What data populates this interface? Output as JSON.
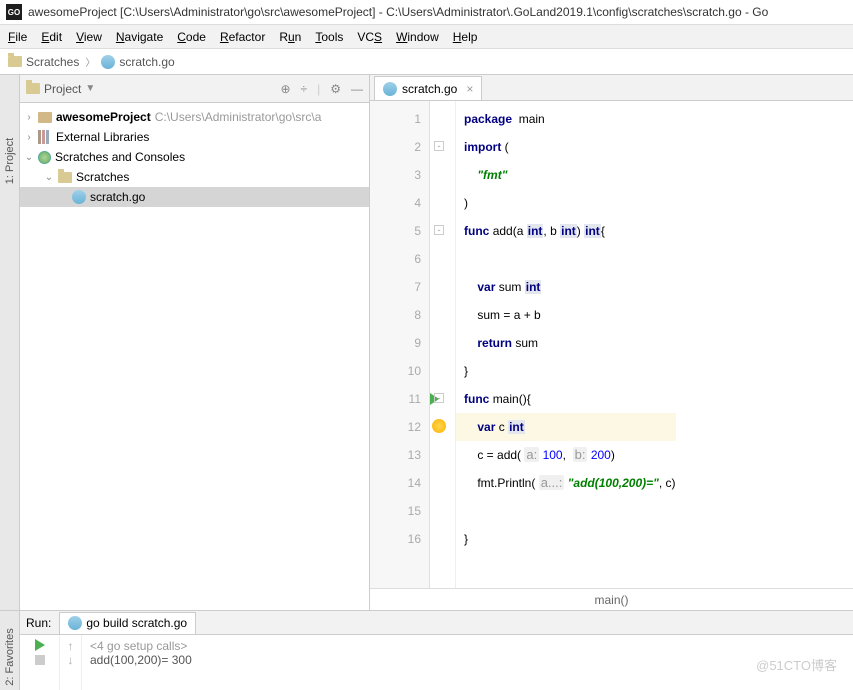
{
  "window": {
    "title": "awesomeProject [C:\\Users\\Administrator\\go\\src\\awesomeProject] - C:\\Users\\Administrator\\.GoLand2019.1\\config\\scratches\\scratch.go - Go"
  },
  "menu": [
    "File",
    "Edit",
    "View",
    "Navigate",
    "Code",
    "Refactor",
    "Run",
    "Tools",
    "VCS",
    "Window",
    "Help"
  ],
  "nav": {
    "root": "Scratches",
    "file": "scratch.go"
  },
  "project": {
    "title": "Project",
    "root": {
      "name": "awesomeProject",
      "path": "C:\\Users\\Administrator\\go\\src\\a"
    },
    "ext": "External Libraries",
    "scr": "Scratches and Consoles",
    "scratches": "Scratches",
    "file": "scratch.go"
  },
  "tabs": {
    "file": "scratch.go"
  },
  "code": {
    "lines": [
      1,
      2,
      3,
      4,
      5,
      6,
      7,
      8,
      9,
      10,
      11,
      12,
      13,
      14,
      15,
      16
    ],
    "pkg": "package",
    "main": "main",
    "import": "import",
    "fmt": "\"fmt\"",
    "func": "func",
    "add": "add",
    "a": "a",
    "int": "int",
    "b": "b",
    "var": "var",
    "sum": "sum",
    "assign": "sum = a + b",
    "return": "return",
    "mainfn": "main",
    "c": "c",
    "call": "c = add(",
    "a100": "a:",
    "v100": "100",
    "b200": "b:",
    "v200": "200",
    "println": "fmt.Println(",
    "ahint": "a...:",
    "strv": "\"add(100,200)=\"",
    "carg": ", c)"
  },
  "breadcrumb": "main()",
  "run": {
    "label": "Run:",
    "tab": "go build scratch.go",
    "calls": "<4 go setup calls>",
    "out": "add(100,200)= 300"
  },
  "sidebar": {
    "project": "1: Project",
    "fav": "2: Favorites"
  },
  "watermark": "@51CTO博客"
}
